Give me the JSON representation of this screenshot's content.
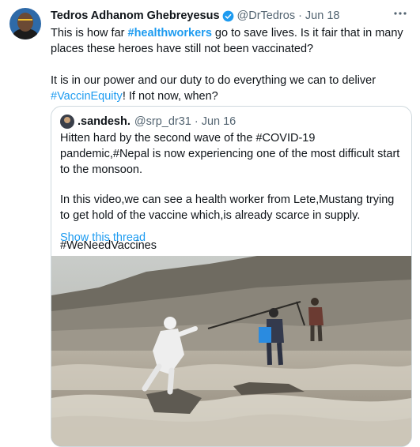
{
  "tweet": {
    "author_name": "Tedros Adhanom Ghebreyesus",
    "author_handle": "@DrTedros",
    "separator": "·",
    "date": "Jun 18",
    "more_icon": "more-horizontal-icon",
    "text": {
      "line1_pre": "This is how far ",
      "line1_tag": "#healthworkers",
      "line1_post": " go to save lives. Is it fair that in many places these heroes have still not been vaccinated?",
      "para2_pre": "It is in our power and our duty to do everything we can to deliver ",
      "para2_tag": "#VaccinEquity",
      "para2_post": "! If not now, when?"
    }
  },
  "quoted_tweet": {
    "author_name": ".sandesh.",
    "author_handle": "@srp_dr31",
    "separator": "·",
    "date": "Jun 16",
    "para1": "Hitten hard by the second wave of the #COVID-19 pandemic,#Nepal is now experiencing one of the most difficult start to the monsoon.",
    "para2": "In this video,we can see a health worker from Lete,Mustang trying to get hold of the vaccine which,is already scarce in supply.",
    "para3": "#WeNeedVaccines",
    "show_thread": "Show this thread",
    "media": {
      "badge": "",
      "watermark": ""
    }
  },
  "colors": {
    "link": "#1d9bf0",
    "secondary_text": "#536471",
    "border": "#cfd9de",
    "verified": "#1d9bf0"
  }
}
